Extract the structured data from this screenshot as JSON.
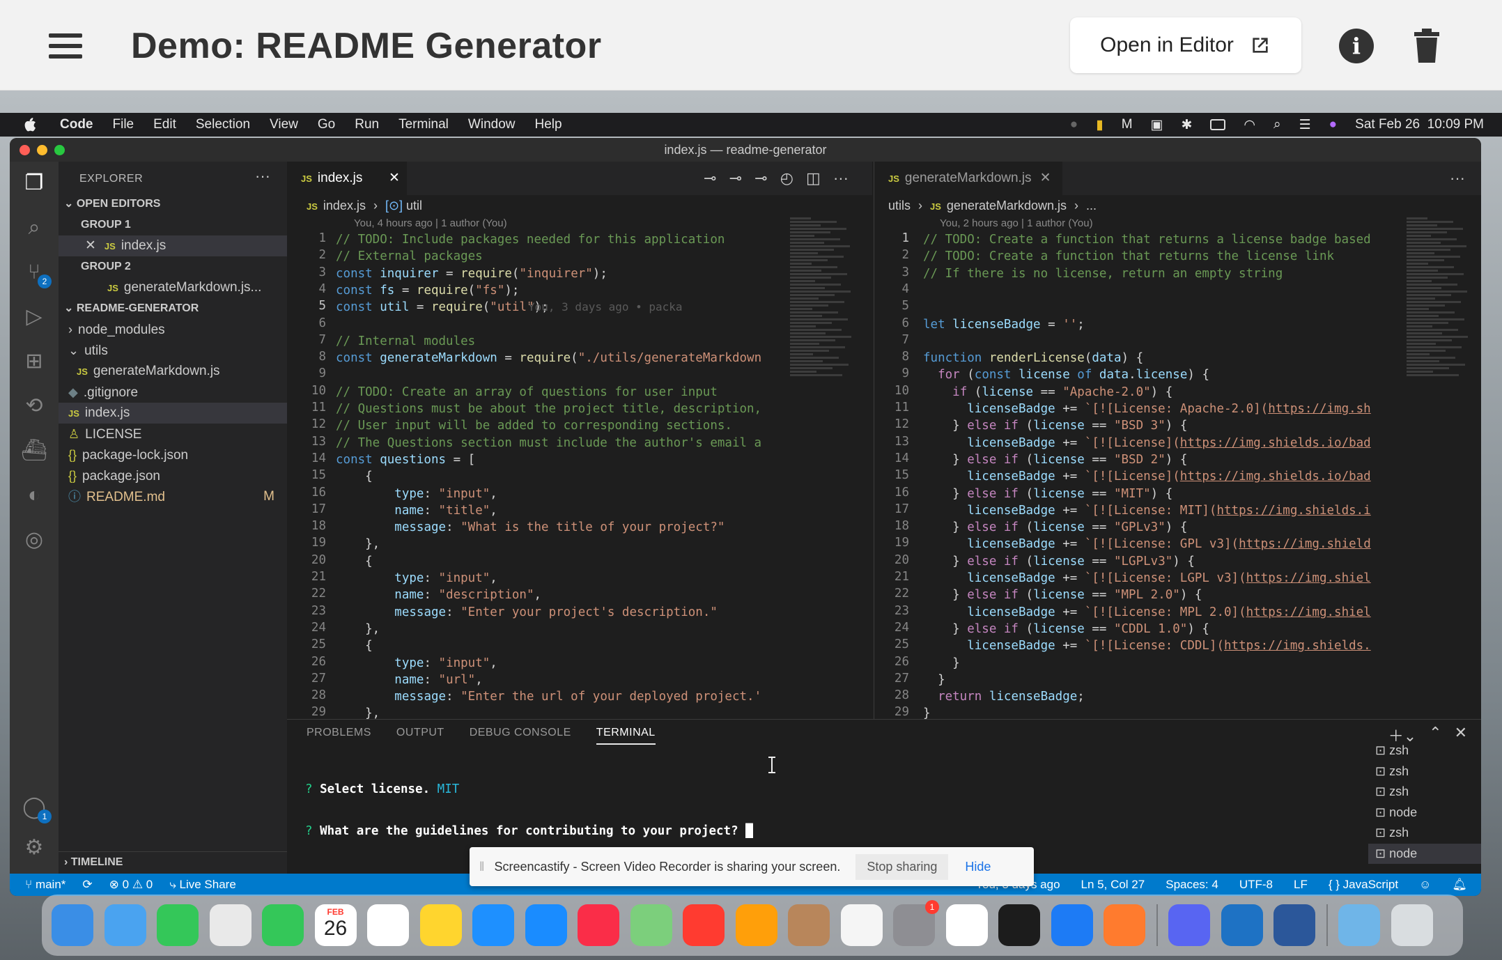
{
  "page": {
    "title": "Demo: README Generator",
    "open_label": "Open in Editor"
  },
  "menubar": {
    "app": "Code",
    "items": [
      "File",
      "Edit",
      "Selection",
      "View",
      "Go",
      "Run",
      "Terminal",
      "Window",
      "Help"
    ],
    "clock": "Sat Feb 26  10:09 PM"
  },
  "window": {
    "title": "index.js — readme-generator"
  },
  "sidebar": {
    "header": "EXPLORER",
    "open_editors": "OPEN EDITORS",
    "group1": "GROUP 1",
    "group1_file": "index.js",
    "group2": "GROUP 2",
    "group2_file": "generateMarkdown.js...",
    "project": "README-GENERATOR",
    "tree": [
      {
        "label": "node_modules",
        "indent": 1,
        "icon": "chevron-right"
      },
      {
        "label": "utils",
        "indent": 1,
        "icon": "chevron-down"
      },
      {
        "label": "generateMarkdown.js",
        "indent": 2,
        "icon": "js"
      },
      {
        "label": ".gitignore",
        "indent": 1,
        "icon": "gear"
      },
      {
        "label": "index.js",
        "indent": 1,
        "icon": "js",
        "selected": true
      },
      {
        "label": "LICENSE",
        "indent": 1,
        "icon": "license"
      },
      {
        "label": "package-lock.json",
        "indent": 1,
        "icon": "json"
      },
      {
        "label": "package.json",
        "indent": 1,
        "icon": "json"
      },
      {
        "label": "README.md",
        "indent": 1,
        "icon": "info",
        "badge": "M"
      }
    ],
    "timeline": "TIMELINE"
  },
  "editor_left": {
    "tab": "index.js",
    "crumb_file": "index.js",
    "crumb_symbol": "util",
    "blame": "You, 4 hours ago | 1 author (You)",
    "inline_blame": "You, 3 days ago • packa",
    "lines": [
      [
        [
          "c",
          "// TODO: Include packages needed for this application"
        ]
      ],
      [
        [
          "c",
          "// External packages"
        ]
      ],
      [
        [
          "k",
          "const "
        ],
        [
          "v",
          "inquirer"
        ],
        [
          "p",
          " = "
        ],
        [
          "f",
          "require"
        ],
        [
          "p",
          "("
        ],
        [
          "s",
          "\"inquirer\""
        ],
        [
          "p",
          ");"
        ]
      ],
      [
        [
          "k",
          "const "
        ],
        [
          "v",
          "fs"
        ],
        [
          "p",
          " = "
        ],
        [
          "f",
          "require"
        ],
        [
          "p",
          "("
        ],
        [
          "s",
          "\"fs\""
        ],
        [
          "p",
          ");"
        ]
      ],
      [
        [
          "k",
          "const "
        ],
        [
          "v",
          "util"
        ],
        [
          "p",
          " = "
        ],
        [
          "f",
          "require"
        ],
        [
          "p",
          "("
        ],
        [
          "s",
          "\"util\""
        ],
        [
          "p",
          ");"
        ]
      ],
      [],
      [
        [
          "c",
          "// Internal modules"
        ]
      ],
      [
        [
          "k",
          "const "
        ],
        [
          "v",
          "generateMarkdown"
        ],
        [
          "p",
          " = "
        ],
        [
          "f",
          "require"
        ],
        [
          "p",
          "("
        ],
        [
          "s",
          "\"./utils/generateMarkdown"
        ]
      ],
      [],
      [
        [
          "c",
          "// TODO: Create an array of questions for user input"
        ]
      ],
      [
        [
          "c",
          "// Questions must be about the project title, description,"
        ]
      ],
      [
        [
          "c",
          "// User input will be added to corresponding sections."
        ]
      ],
      [
        [
          "c",
          "// The Questions section must include the author's email a"
        ]
      ],
      [
        [
          "k",
          "const "
        ],
        [
          "v",
          "questions"
        ],
        [
          "p",
          " = ["
        ]
      ],
      [
        [
          "p",
          "    {"
        ]
      ],
      [
        [
          "p",
          "        "
        ],
        [
          "v",
          "type"
        ],
        [
          "p",
          ": "
        ],
        [
          "s",
          "\"input\""
        ],
        [
          "p",
          ","
        ]
      ],
      [
        [
          "p",
          "        "
        ],
        [
          "v",
          "name"
        ],
        [
          "p",
          ": "
        ],
        [
          "s",
          "\"title\""
        ],
        [
          "p",
          ","
        ]
      ],
      [
        [
          "p",
          "        "
        ],
        [
          "v",
          "message"
        ],
        [
          "p",
          ": "
        ],
        [
          "s",
          "\"What is the title of your project?\""
        ]
      ],
      [
        [
          "p",
          "    },"
        ]
      ],
      [
        [
          "p",
          "    {"
        ]
      ],
      [
        [
          "p",
          "        "
        ],
        [
          "v",
          "type"
        ],
        [
          "p",
          ": "
        ],
        [
          "s",
          "\"input\""
        ],
        [
          "p",
          ","
        ]
      ],
      [
        [
          "p",
          "        "
        ],
        [
          "v",
          "name"
        ],
        [
          "p",
          ": "
        ],
        [
          "s",
          "\"description\""
        ],
        [
          "p",
          ","
        ]
      ],
      [
        [
          "p",
          "        "
        ],
        [
          "v",
          "message"
        ],
        [
          "p",
          ": "
        ],
        [
          "s",
          "\"Enter your project's description.\""
        ]
      ],
      [
        [
          "p",
          "    },"
        ]
      ],
      [
        [
          "p",
          "    {"
        ]
      ],
      [
        [
          "p",
          "        "
        ],
        [
          "v",
          "type"
        ],
        [
          "p",
          ": "
        ],
        [
          "s",
          "\"input\""
        ],
        [
          "p",
          ","
        ]
      ],
      [
        [
          "p",
          "        "
        ],
        [
          "v",
          "name"
        ],
        [
          "p",
          ": "
        ],
        [
          "s",
          "\"url\""
        ],
        [
          "p",
          ","
        ]
      ],
      [
        [
          "p",
          "        "
        ],
        [
          "v",
          "message"
        ],
        [
          "p",
          ": "
        ],
        [
          "s",
          "\"Enter the url of your deployed project.'"
        ]
      ],
      [
        [
          "p",
          "    },"
        ]
      ]
    ]
  },
  "editor_right": {
    "tab": "generateMarkdown.js",
    "crumb_folder": "utils",
    "crumb_file": "generateMarkdown.js",
    "crumb_more": "...",
    "blame": "You, 2 hours ago | 1 author (You)",
    "lines": [
      [
        [
          "c",
          "// TODO: Create a function that returns a license badge based"
        ]
      ],
      [
        [
          "c",
          "// TODO: Create a function that returns the license link"
        ]
      ],
      [
        [
          "c",
          "// If there is no license, return an empty string"
        ]
      ],
      [],
      [],
      [
        [
          "k",
          "let "
        ],
        [
          "v",
          "licenseBadge"
        ],
        [
          "p",
          " = "
        ],
        [
          "s",
          "''"
        ],
        [
          "p",
          ";"
        ]
      ],
      [],
      [
        [
          "k",
          "function "
        ],
        [
          "f",
          "renderLicense"
        ],
        [
          "p",
          "("
        ],
        [
          "v",
          "data"
        ],
        [
          "p",
          ") {"
        ]
      ],
      [
        [
          "p",
          "  "
        ],
        [
          "kw",
          "for "
        ],
        [
          "p",
          "("
        ],
        [
          "k",
          "const "
        ],
        [
          "v",
          "license"
        ],
        [
          "k",
          " of "
        ],
        [
          "v",
          "data"
        ],
        [
          "p",
          "."
        ],
        [
          "v",
          "license"
        ],
        [
          "p",
          ") {"
        ]
      ],
      [
        [
          "p",
          "    "
        ],
        [
          "kw",
          "if "
        ],
        [
          "p",
          "("
        ],
        [
          "v",
          "license"
        ],
        [
          "p",
          " == "
        ],
        [
          "s",
          "\"Apache-2.0\""
        ],
        [
          "p",
          ") {"
        ]
      ],
      [
        [
          "p",
          "      "
        ],
        [
          "v",
          "licenseBadge"
        ],
        [
          "p",
          " += "
        ],
        [
          "s",
          "`[![License: Apache-2.0]("
        ],
        [
          "u",
          "https://img.sh"
        ]
      ],
      [
        [
          "p",
          "    } "
        ],
        [
          "kw",
          "else if "
        ],
        [
          "p",
          "("
        ],
        [
          "v",
          "license"
        ],
        [
          "p",
          " == "
        ],
        [
          "s",
          "\"BSD 3\""
        ],
        [
          "p",
          ") {"
        ]
      ],
      [
        [
          "p",
          "      "
        ],
        [
          "v",
          "licenseBadge"
        ],
        [
          "p",
          " += "
        ],
        [
          "s",
          "`[![License]("
        ],
        [
          "u",
          "https://img.shields.io/bad"
        ]
      ],
      [
        [
          "p",
          "    } "
        ],
        [
          "kw",
          "else if "
        ],
        [
          "p",
          "("
        ],
        [
          "v",
          "license"
        ],
        [
          "p",
          " == "
        ],
        [
          "s",
          "\"BSD 2\""
        ],
        [
          "p",
          ") {"
        ]
      ],
      [
        [
          "p",
          "      "
        ],
        [
          "v",
          "licenseBadge"
        ],
        [
          "p",
          " += "
        ],
        [
          "s",
          "`[![License]("
        ],
        [
          "u",
          "https://img.shields.io/bad"
        ]
      ],
      [
        [
          "p",
          "    } "
        ],
        [
          "kw",
          "else if "
        ],
        [
          "p",
          "("
        ],
        [
          "v",
          "license"
        ],
        [
          "p",
          " == "
        ],
        [
          "s",
          "\"MIT\""
        ],
        [
          "p",
          ") {"
        ]
      ],
      [
        [
          "p",
          "      "
        ],
        [
          "v",
          "licenseBadge"
        ],
        [
          "p",
          " += "
        ],
        [
          "s",
          "`[![License: MIT]("
        ],
        [
          "u",
          "https://img.shields.i"
        ]
      ],
      [
        [
          "p",
          "    } "
        ],
        [
          "kw",
          "else if "
        ],
        [
          "p",
          "("
        ],
        [
          "v",
          "license"
        ],
        [
          "p",
          " == "
        ],
        [
          "s",
          "\"GPLv3\""
        ],
        [
          "p",
          ") {"
        ]
      ],
      [
        [
          "p",
          "      "
        ],
        [
          "v",
          "licenseBadge"
        ],
        [
          "p",
          " += "
        ],
        [
          "s",
          "`[![License: GPL v3]("
        ],
        [
          "u",
          "https://img.shield"
        ]
      ],
      [
        [
          "p",
          "    } "
        ],
        [
          "kw",
          "else if "
        ],
        [
          "p",
          "("
        ],
        [
          "v",
          "license"
        ],
        [
          "p",
          " == "
        ],
        [
          "s",
          "\"LGPLv3\""
        ],
        [
          "p",
          ") {"
        ]
      ],
      [
        [
          "p",
          "      "
        ],
        [
          "v",
          "licenseBadge"
        ],
        [
          "p",
          " += "
        ],
        [
          "s",
          "`[![License: LGPL v3]("
        ],
        [
          "u",
          "https://img.shiel"
        ]
      ],
      [
        [
          "p",
          "    } "
        ],
        [
          "kw",
          "else if "
        ],
        [
          "p",
          "("
        ],
        [
          "v",
          "license"
        ],
        [
          "p",
          " == "
        ],
        [
          "s",
          "\"MPL 2.0\""
        ],
        [
          "p",
          ") {"
        ]
      ],
      [
        [
          "p",
          "      "
        ],
        [
          "v",
          "licenseBadge"
        ],
        [
          "p",
          " += "
        ],
        [
          "s",
          "`[![License: MPL 2.0]("
        ],
        [
          "u",
          "https://img.shiel"
        ]
      ],
      [
        [
          "p",
          "    } "
        ],
        [
          "kw",
          "else if "
        ],
        [
          "p",
          "("
        ],
        [
          "v",
          "license"
        ],
        [
          "p",
          " == "
        ],
        [
          "s",
          "\"CDDL 1.0\""
        ],
        [
          "p",
          ") {"
        ]
      ],
      [
        [
          "p",
          "      "
        ],
        [
          "v",
          "licenseBadge"
        ],
        [
          "p",
          " += "
        ],
        [
          "s",
          "`[![License: CDDL]("
        ],
        [
          "u",
          "https://img.shields."
        ]
      ],
      [
        [
          "p",
          "    }"
        ]
      ],
      [
        [
          "p",
          "  }"
        ]
      ],
      [
        [
          "p",
          "  "
        ],
        [
          "kw",
          "return "
        ],
        [
          "v",
          "licenseBadge"
        ],
        [
          "p",
          ";"
        ]
      ],
      [
        [
          "p",
          "}"
        ]
      ]
    ]
  },
  "panel": {
    "tabs": [
      "PROBLEMS",
      "OUTPUT",
      "DEBUG CONSOLE",
      "TERMINAL"
    ],
    "active_tab": "TERMINAL",
    "terminal_lines": [
      {
        "prompt": "? ",
        "text": "Select license. ",
        "answer": "MIT"
      },
      {
        "prompt": "? ",
        "text": "What are the guidelines for contributing to your project? ",
        "answer": ""
      }
    ],
    "terminals": [
      "zsh",
      "zsh",
      "zsh",
      "node",
      "zsh",
      "node"
    ]
  },
  "statusbar": {
    "branch": "main*",
    "errors": "0",
    "warnings": "0",
    "live_share": "Live Share",
    "blame": "You, 3 days ago",
    "position": "Ln 5, Col 27",
    "spaces": "Spaces: 4",
    "encoding": "UTF-8",
    "eol": "LF",
    "language": "JavaScript"
  },
  "share_bar": {
    "message": "Screencastify - Screen Video Recorder is sharing your screen.",
    "stop": "Stop sharing",
    "hide": "Hide"
  },
  "dock": {
    "calendar_month": "FEB",
    "calendar_day": "26",
    "settings_badge": "1",
    "apps": [
      {
        "name": "finder",
        "color": "#3a8ee6"
      },
      {
        "name": "mail",
        "color": "#4aa3f0"
      },
      {
        "name": "messages",
        "color": "#34c759"
      },
      {
        "name": "chrome",
        "color": "#e9e9e9"
      },
      {
        "name": "facetime",
        "color": "#34c759"
      },
      {
        "name": "calendar",
        "color": "#ffffff"
      },
      {
        "name": "reminders",
        "color": "#ffffff"
      },
      {
        "name": "notes",
        "color": "#ffd52e"
      },
      {
        "name": "safari",
        "color": "#1e90ff"
      },
      {
        "name": "app-store",
        "color": "#1a8cff"
      },
      {
        "name": "music",
        "color": "#fa2d48"
      },
      {
        "name": "maps",
        "color": "#7ccf7c"
      },
      {
        "name": "news",
        "color": "#ff3b30"
      },
      {
        "name": "pages",
        "color": "#ff9f0a"
      },
      {
        "name": "contacts",
        "color": "#b8865b"
      },
      {
        "name": "photos",
        "color": "#f5f5f5"
      },
      {
        "name": "system-preferences",
        "color": "#8e8e93"
      },
      {
        "name": "slack",
        "color": "#ffffff"
      },
      {
        "name": "terminal",
        "color": "#1c1c1c"
      },
      {
        "name": "xcode",
        "color": "#1d7bf5"
      },
      {
        "name": "sketch",
        "color": "#ff7b2e"
      },
      {
        "name": "discord",
        "color": "#5865f2"
      },
      {
        "name": "vscode",
        "color": "#1e72c4"
      },
      {
        "name": "word",
        "color": "#2b579a"
      },
      {
        "name": "downloads",
        "color": "#6fb5e8"
      },
      {
        "name": "trash",
        "color": "#d9dde0"
      }
    ]
  }
}
